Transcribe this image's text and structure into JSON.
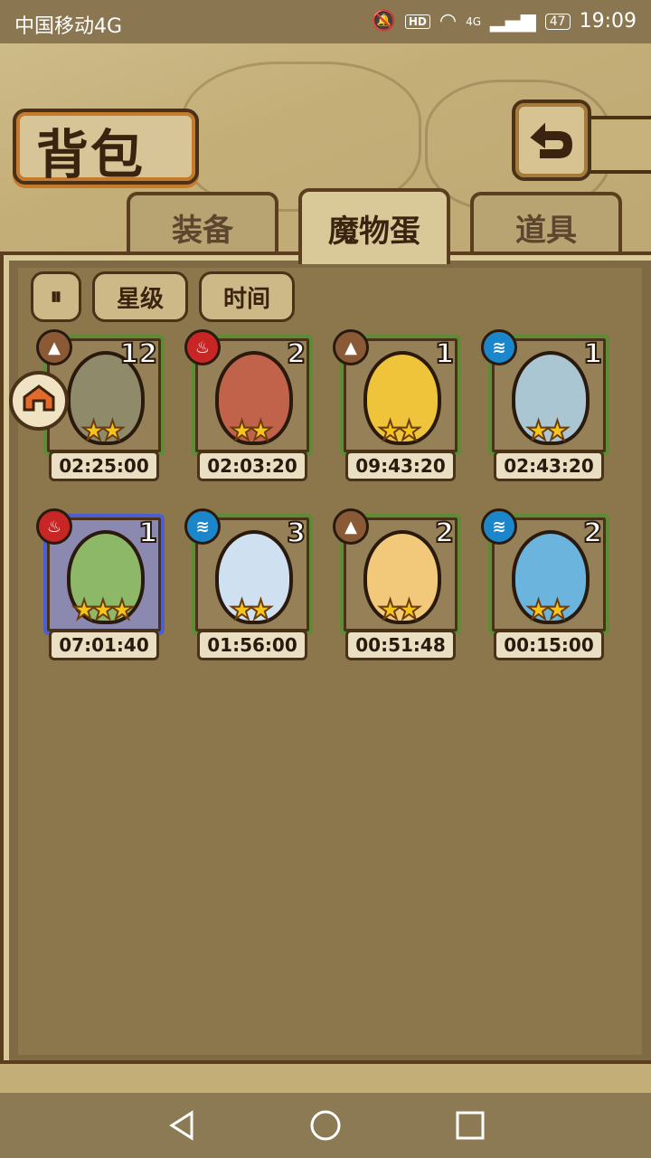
{
  "status_bar": {
    "carrier": "中国移动4G",
    "hd": "HD",
    "signal": "4G",
    "battery": "47",
    "time": "19:09"
  },
  "header": {
    "title": "背包"
  },
  "tabs": [
    {
      "label": "装备",
      "active": false
    },
    {
      "label": "魔物蛋",
      "active": true
    },
    {
      "label": "道具",
      "active": false
    }
  ],
  "filters": {
    "sort_toggle_icon": "sort-toggle-icon",
    "star": "星级",
    "time": "时间"
  },
  "eggs": [
    {
      "element": "earth",
      "count": "12",
      "stars": "★★",
      "timer": "02:25:00",
      "color": "#8f8a6a"
    },
    {
      "element": "fire",
      "count": "2",
      "stars": "★★",
      "timer": "02:03:20",
      "color": "#c0634a"
    },
    {
      "element": "earth",
      "count": "1",
      "stars": "★★",
      "timer": "09:43:20",
      "color": "#f0c43a"
    },
    {
      "element": "water",
      "count": "1",
      "stars": "★★",
      "timer": "02:43:20",
      "color": "#a9c6d2"
    },
    {
      "element": "fire",
      "count": "1",
      "stars": "★★★",
      "timer": "07:01:40",
      "color": "#8cb867",
      "selected": true
    },
    {
      "element": "water",
      "count": "3",
      "stars": "★★",
      "timer": "01:56:00",
      "color": "#cfe0f0"
    },
    {
      "element": "earth",
      "count": "2",
      "stars": "★★",
      "timer": "00:51:48",
      "color": "#f2c97a"
    },
    {
      "element": "water",
      "count": "2",
      "stars": "★★",
      "timer": "00:15:00",
      "color": "#6ab4dd"
    }
  ],
  "colors": {
    "fire": "#c82525",
    "water": "#1b86c9",
    "earth": "#8a5a36",
    "slot_border": "#5d8b36",
    "selected_border": "#4b5fd2"
  }
}
